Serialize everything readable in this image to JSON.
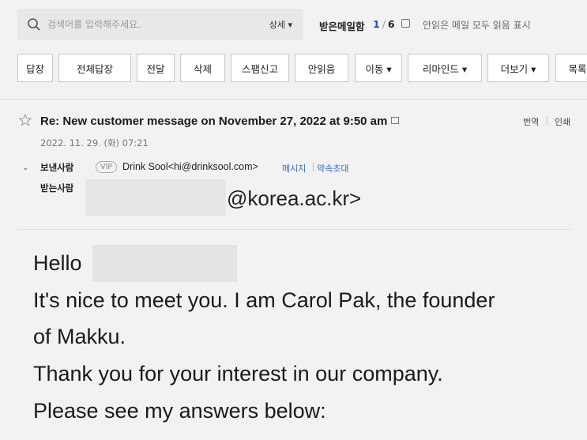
{
  "search": {
    "placeholder": "검색어를 입력해주세요.",
    "detail_label": "상세 ▾"
  },
  "inbox": {
    "label": "받은메일함",
    "current": "1",
    "total": "6",
    "mark_all_read": "안읽은 메일 모두 읽음 표시"
  },
  "toolbar": {
    "buttons": [
      "답장",
      "전체답장",
      "전달",
      "삭제",
      "스팸신고",
      "안읽음",
      "이동 ▾",
      "리마인드 ▾",
      "더보기 ▾",
      "목록"
    ]
  },
  "mail": {
    "subject": "Re: New customer message on November 27, 2022 at 9:50 am",
    "translate": "번역",
    "print": "인쇄",
    "date": "2022. 11. 29. (화) 07:21",
    "from_label": "보낸사람",
    "vip": "VIP",
    "sender": "Drink Sool<hi@drinksool.com>",
    "message_link": "메시지",
    "invite_link": "약속초대",
    "to_label": "받는사람",
    "to_domain": "@korea.ac.kr>"
  },
  "body": {
    "lines": [
      "Hello",
      "It's nice to meet you. I am Carol Pak, the founder",
      "of Makku.",
      "Thank you for your interest in our company.",
      "Please see my answers below:"
    ]
  }
}
